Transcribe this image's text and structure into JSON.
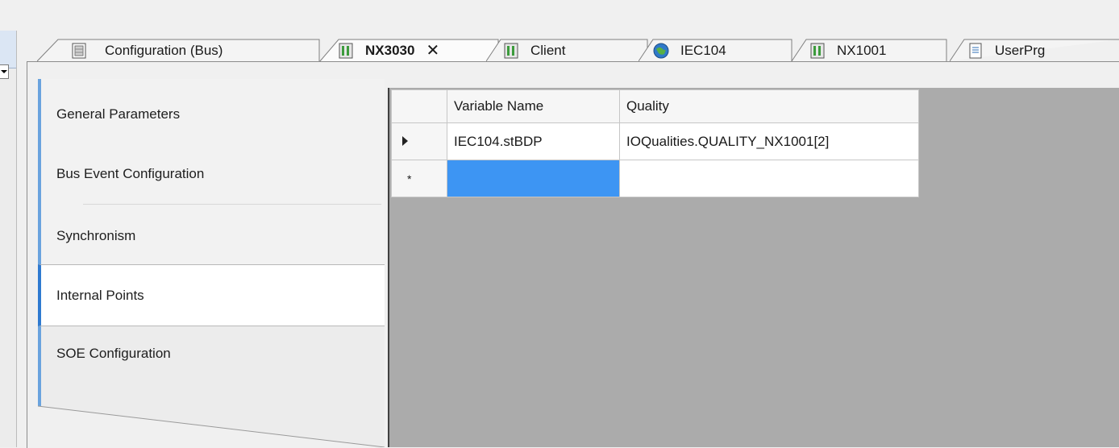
{
  "tabs": [
    {
      "label": "Configuration (Bus)",
      "icon": "bus-config-icon",
      "active": false
    },
    {
      "label": "NX3030",
      "icon": "device-icon",
      "active": true,
      "close": "✕"
    },
    {
      "label": "Client",
      "icon": "device-icon",
      "active": false
    },
    {
      "label": "IEC104",
      "icon": "globe-icon",
      "active": false
    },
    {
      "label": "NX1001",
      "icon": "device-icon",
      "active": false
    },
    {
      "label": "UserPrg",
      "icon": "document-icon",
      "active": false
    }
  ],
  "sidebar": {
    "items": [
      {
        "label": "General Parameters"
      },
      {
        "label": "Bus Event Configuration"
      },
      {
        "label": "Synchronism"
      },
      {
        "label": "Internal Points",
        "selected": true
      },
      {
        "label": "SOE Configuration"
      }
    ]
  },
  "grid": {
    "columns": [
      "Variable Name",
      "Quality"
    ],
    "rows": [
      {
        "marker": "current-row-arrow",
        "variable": "IEC104.stBDP",
        "quality": "IOQualities.QUALITY_NX1001[2]"
      },
      {
        "marker": "*",
        "variable": "",
        "quality": ""
      }
    ]
  },
  "colors": {
    "selection": "#3d95f3",
    "sidebar_accent": "#2f7ad0",
    "grid_background": "#ababab"
  }
}
